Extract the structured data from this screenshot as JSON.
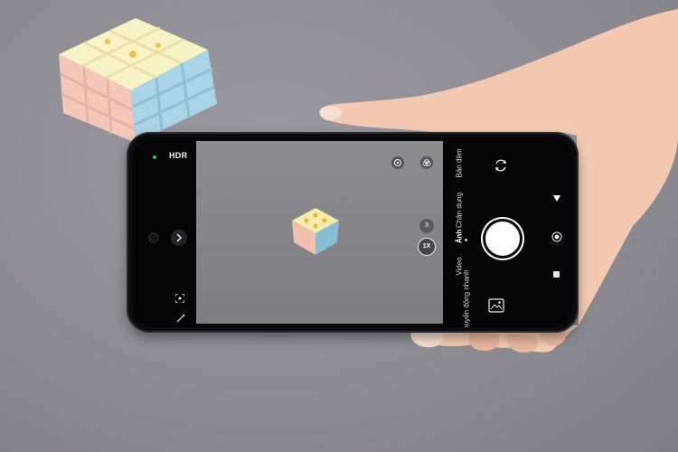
{
  "camera": {
    "hdr_label": "HDR",
    "zoom_level_small": "3",
    "zoom_level_active": "1X",
    "modes": [
      {
        "label": "Bản đêm"
      },
      {
        "label": "Chân dung"
      },
      {
        "label": "Ảnh",
        "active": true
      },
      {
        "label": "Video"
      },
      {
        "label": "Chuyển động nhanh"
      }
    ],
    "active_mode_indicator_color": "#f0c33c"
  },
  "icons": {
    "flash_status": "green-dot-indicator",
    "viewfinder_left": "lens-filter-icon",
    "viewfinder_right": "color-filter-icon",
    "switch_camera": "rotate-camera-icon",
    "menu_toggle": "triangle-menu-icon",
    "shutter": "shutter-button",
    "record": "record-icon",
    "stop": "stop-icon",
    "gallery": "gallery-icon",
    "expand": "chevron-right-icon",
    "focus": "focus-frame-icon",
    "magic": "magic-wand-icon"
  },
  "colors": {
    "background": "#8e8d93",
    "phone_body": "#0c0c0e",
    "flash_indicator": "#27d04f",
    "skin": "#f2c9b0"
  }
}
